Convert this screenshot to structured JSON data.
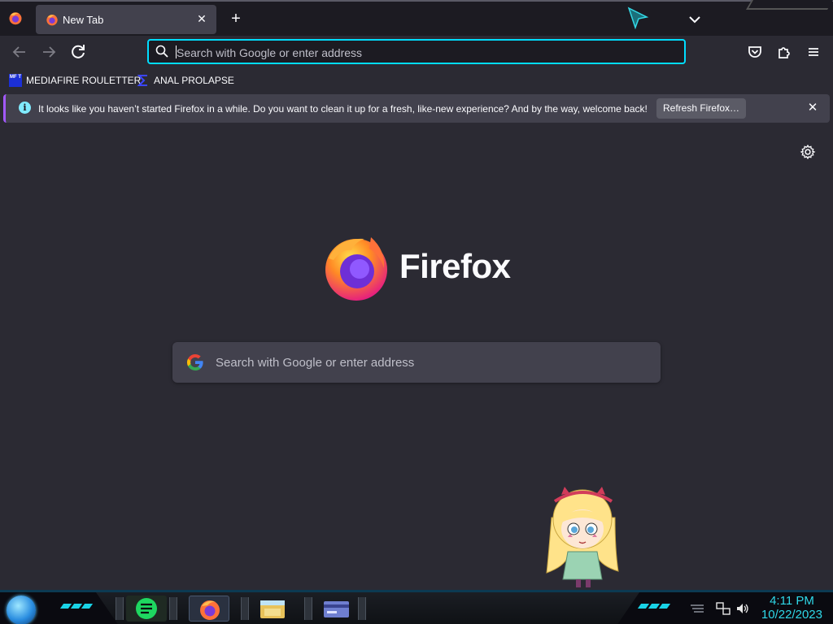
{
  "tabs": [
    {
      "title": "New Tab",
      "close_label": "✕"
    }
  ],
  "new_tab_label": "+",
  "urlbar": {
    "placeholder": "Search with Google or enter address"
  },
  "bookmarks": [
    {
      "label": "MEDIAFIRE ROULETTER",
      "icon": "mediafire-icon",
      "icon_text": "MF T"
    },
    {
      "label": "ANAL PROLAPSE",
      "icon": "sigma-icon"
    }
  ],
  "notification": {
    "message": "It looks like you haven’t started Firefox in a while. Do you want to clean it up for a fresh, like-new experience? And by the way, welcome back!",
    "button": "Refresh Firefox…",
    "info_glyph": "i",
    "close_label": "✕"
  },
  "newtab": {
    "brand": "Firefox",
    "search_placeholder": "Search with Google or enter address"
  },
  "taskbar": {
    "apps": [
      "notes-icon",
      "firefox-icon",
      "file-explorer-icon",
      "card-app-icon"
    ],
    "time": "4:11 PM",
    "date": "10/22/2023"
  },
  "colors": {
    "accent": "#00ddff",
    "toolbar": "#2b2a33",
    "tab_active": "#42414d",
    "taskbar_text": "#2fd8e8"
  }
}
